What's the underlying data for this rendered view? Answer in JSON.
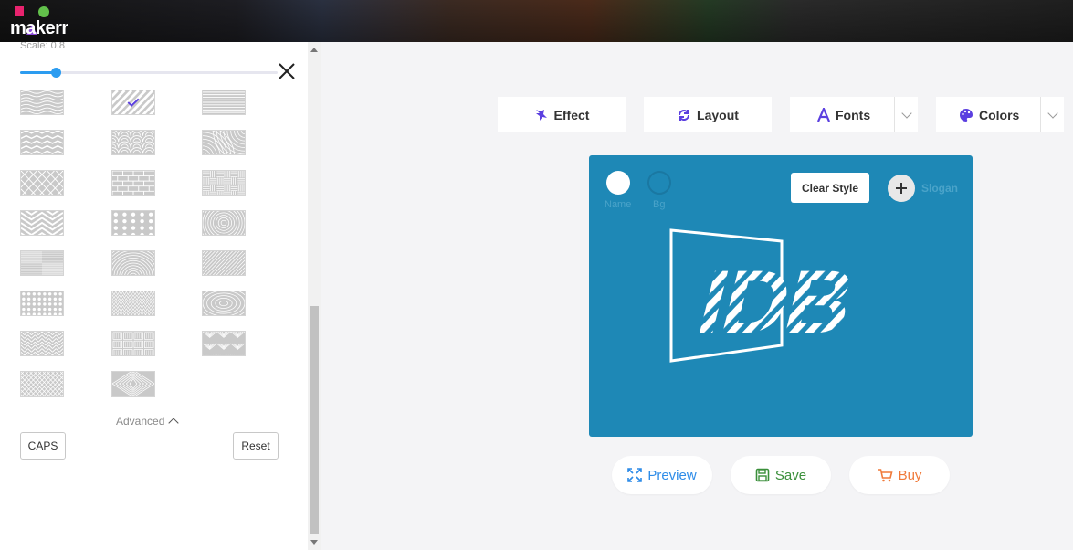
{
  "header": {
    "logo_line1": "logo",
    "logo_line2": "makerr"
  },
  "sidebar": {
    "scale_label": "Scale:",
    "scale_value": "0.8",
    "scale_fraction": 0.14,
    "selected_pattern": 1,
    "patterns": [
      "wavy-lines",
      "diagonal-stripes",
      "horizontal-lines",
      "zigzag",
      "scales",
      "swirls",
      "diamonds",
      "bricks",
      "basketweave",
      "chevron",
      "dots",
      "concentric-circles",
      "tiles",
      "arcs",
      "fine-diagonal",
      "polka-dots",
      "knit",
      "rings",
      "herringbone",
      "block-weave",
      "folded-squares",
      "crosshatch",
      "diamond-lines"
    ],
    "advanced_label": "Advanced",
    "caps_label": "CAPS",
    "reset_label": "Reset"
  },
  "toolbar": {
    "effect_label": "Effect",
    "layout_label": "Layout",
    "fonts_label": "Fonts",
    "colors_label": "Colors",
    "accent": "#5b3fe0"
  },
  "canvas": {
    "background": "#1e88b6",
    "name_label": "Name",
    "bg_label": "Bg",
    "name_color": "#ffffff",
    "bg_color": "#1e88b6",
    "clear_style_label": "Clear Style",
    "slogan_label": "Slogan",
    "logo_text": "IDB"
  },
  "actions": {
    "preview_label": "Preview",
    "save_label": "Save",
    "buy_label": "Buy",
    "preview_color": "#2e8ce8",
    "save_color": "#3a8f3a",
    "buy_color": "#f07a3a"
  }
}
